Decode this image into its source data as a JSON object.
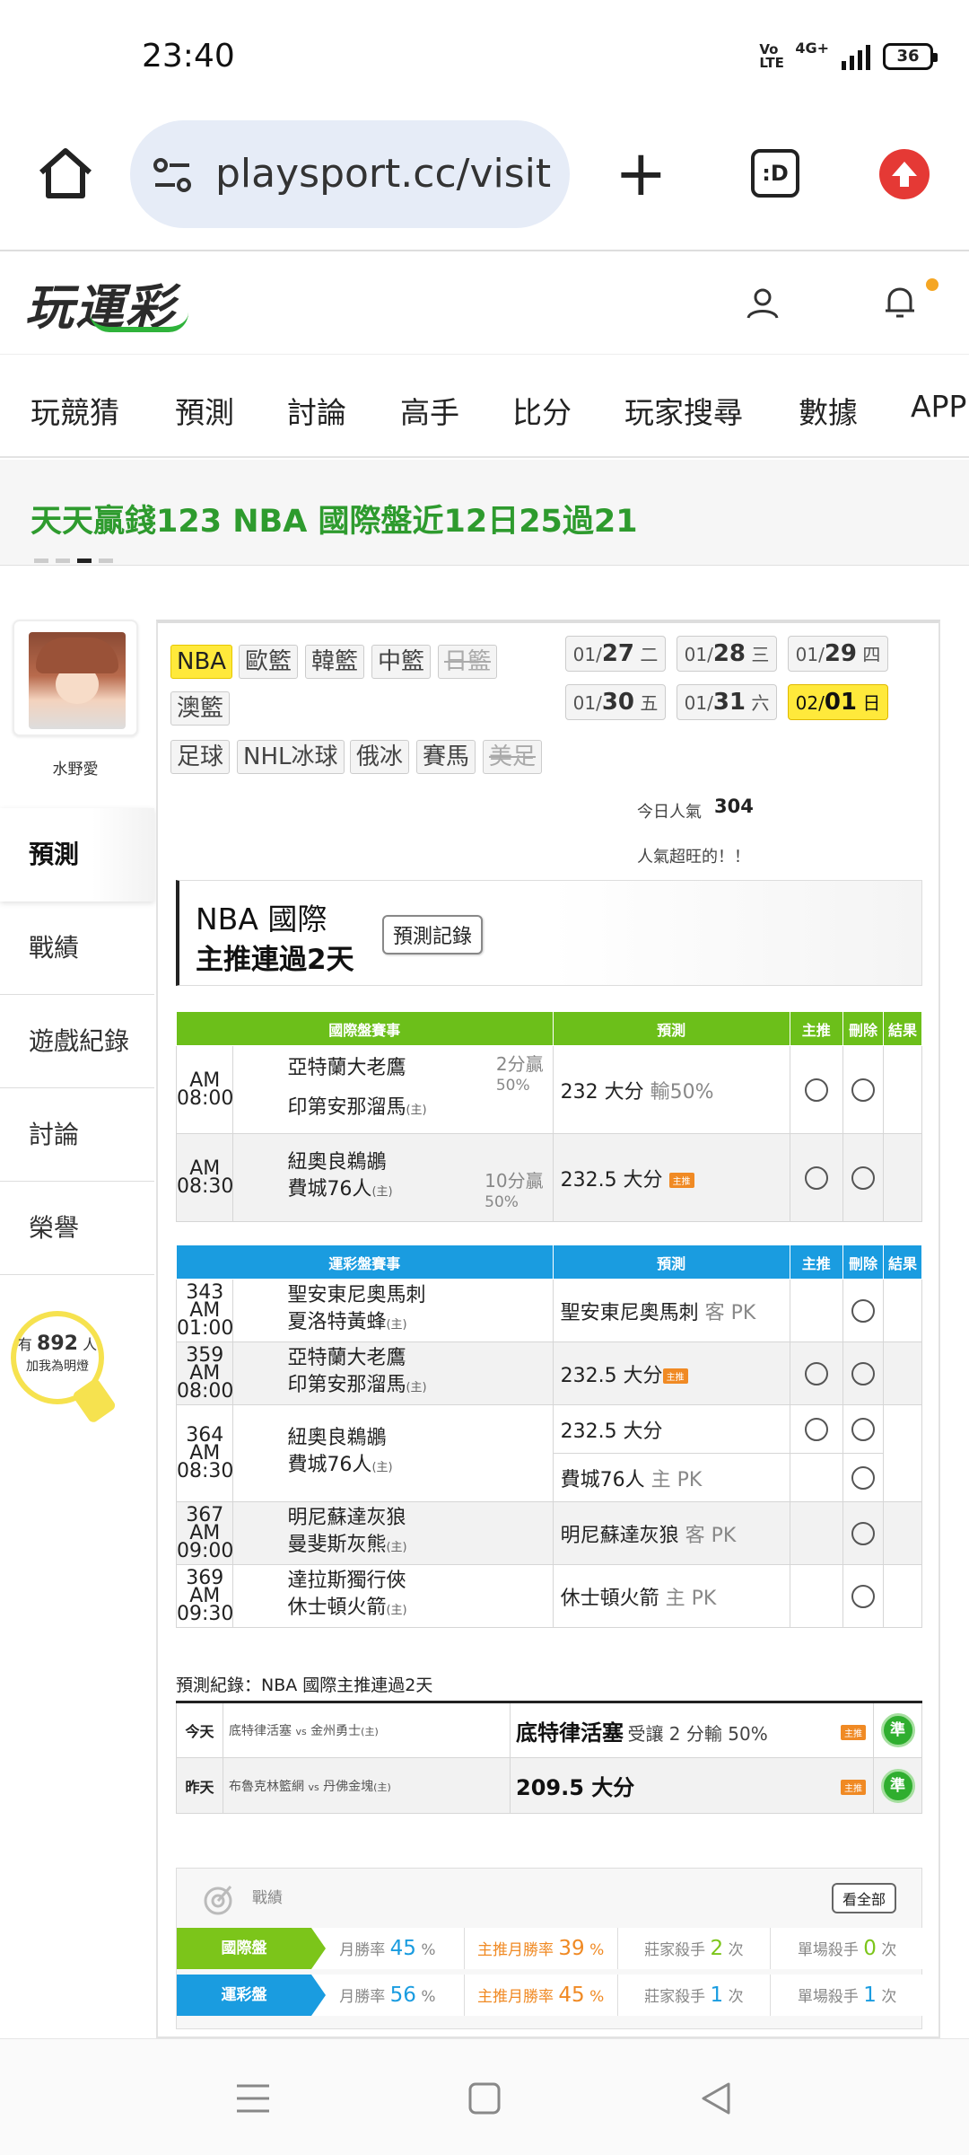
{
  "status_bar": {
    "time": "23:40",
    "volte": "Vo LTE",
    "network": "4G+",
    "battery": "36"
  },
  "browser": {
    "url": "playsport.cc/visit",
    "tabs_label": ":D"
  },
  "site": {
    "logo": "玩運彩",
    "nav": [
      "玩競猜",
      "預測",
      "討論",
      "高手",
      "比分",
      "玩家搜尋",
      "數據",
      "APP"
    ]
  },
  "promo": {
    "text": "天天贏錢123  NBA 國際盤近12日25過21"
  },
  "sidebar": {
    "username": "水野愛",
    "items": [
      "預測",
      "戰績",
      "遊戲紀錄",
      "討論",
      "榮譽"
    ],
    "fans_prefix": "有",
    "fans_count": "892",
    "fans_suffix": "人",
    "fans_text": "加我為明燈"
  },
  "leagues": [
    {
      "label": "NBA",
      "state": "on"
    },
    {
      "label": "歐籃",
      "state": ""
    },
    {
      "label": "韓籃",
      "state": ""
    },
    {
      "label": "中籃",
      "state": ""
    },
    {
      "label": "日籃",
      "state": "off"
    },
    {
      "label": "澳籃",
      "state": ""
    },
    {
      "label": "足球",
      "state": ""
    },
    {
      "label": "NHL冰球",
      "state": ""
    },
    {
      "label": "俄冰",
      "state": ""
    },
    {
      "label": "賽馬",
      "state": ""
    },
    {
      "label": "美足",
      "state": "off"
    }
  ],
  "dates": [
    {
      "month": "01/",
      "day": "27",
      "wd": "二",
      "on": false
    },
    {
      "month": "01/",
      "day": "28",
      "wd": "三",
      "on": false
    },
    {
      "month": "01/",
      "day": "29",
      "wd": "四",
      "on": false
    },
    {
      "month": "01/",
      "day": "30",
      "wd": "五",
      "on": false
    },
    {
      "month": "01/",
      "day": "31",
      "wd": "六",
      "on": false
    },
    {
      "month": "02/",
      "day": "01",
      "wd": "日",
      "on": true
    }
  ],
  "popularity": {
    "label": "今日人氣",
    "value": "304",
    "note": "人氣超旺的！！"
  },
  "headline": {
    "title": "NBA 國際",
    "subtitle": "主推連過2天",
    "button": "預測記錄"
  },
  "intl_table": {
    "headers": [
      "國際盤賽事",
      "預測",
      "主推",
      "刪除",
      "結果"
    ],
    "rows": [
      {
        "time": "AM 08:00",
        "away": "亞特蘭大老鷹",
        "home": "印第安那溜馬",
        "home_tag": "(主)",
        "handicap": "2分贏",
        "handicap_pct": "50%",
        "pick": "232 大分",
        "pick_note": "輸50%",
        "tag": "",
        "main_radio": true,
        "del_radio": true
      },
      {
        "time": "AM 08:30",
        "away": "紐奧良鵜鶘",
        "home": "費城76人",
        "home_tag": "(主)",
        "handicap": "10分贏",
        "handicap_pct": "50%",
        "pick": "232.5 大分",
        "pick_note": "",
        "tag": "主推",
        "main_radio": true,
        "del_radio": true
      }
    ]
  },
  "lottery_table": {
    "headers": [
      "運彩盤賽事",
      "預測",
      "主推",
      "刪除",
      "結果"
    ],
    "rows": [
      {
        "no": "343",
        "time": "AM 01:00",
        "away": "聖安東尼奧馬刺",
        "home": "夏洛特黃蜂",
        "home_tag": "(主)",
        "picks": [
          {
            "text": "聖安東尼奧馬刺",
            "note": "客 PK",
            "tag": "",
            "main": false,
            "del": true
          }
        ]
      },
      {
        "no": "359",
        "time": "AM 08:00",
        "away": "亞特蘭大老鷹",
        "home": "印第安那溜馬",
        "home_tag": "(主)",
        "picks": [
          {
            "text": "232.5 大分",
            "note": "",
            "tag": "主推",
            "main": true,
            "del": true
          }
        ]
      },
      {
        "no": "364",
        "time": "AM 08:30",
        "away": "紐奧良鵜鶘",
        "home": "費城76人",
        "home_tag": "(主)",
        "picks": [
          {
            "text": "232.5 大分",
            "note": "",
            "tag": "",
            "main": true,
            "del": true
          },
          {
            "text": "費城76人",
            "note": "主 PK",
            "tag": "",
            "main": false,
            "del": true
          }
        ]
      },
      {
        "no": "367",
        "time": "AM 09:00",
        "away": "明尼蘇達灰狼",
        "home": "曼斐斯灰熊",
        "home_tag": "(主)",
        "picks": [
          {
            "text": "明尼蘇達灰狼",
            "note": "客 PK",
            "tag": "",
            "main": false,
            "del": true
          }
        ]
      },
      {
        "no": "369",
        "time": "AM 09:30",
        "away": "達拉斯獨行俠",
        "home": "休士頓火箭",
        "home_tag": "(主)",
        "picks": [
          {
            "text": "休士頓火箭",
            "note": "主 PK",
            "tag": "",
            "main": false,
            "del": true
          }
        ]
      }
    ]
  },
  "records": {
    "title": "預測紀錄：NBA 國際主推連過2天",
    "rows": [
      {
        "day": "今天",
        "away": "底特律活塞",
        "vs": "vs",
        "home": "金州勇士",
        "home_tag": "(主)",
        "pick": "底特律活塞",
        "note": "受讓 2 分輸 50%",
        "tag": "主推",
        "result": "準"
      },
      {
        "day": "昨天",
        "away": "布魯克林籃網",
        "vs": "vs",
        "home": "丹佛金塊",
        "home_tag": "(主)",
        "pick": "209.5 大分",
        "note": "",
        "tag": "主推",
        "result": "準"
      }
    ]
  },
  "stats": {
    "title": "戰績",
    "view_all": "看全部",
    "rows": [
      {
        "label": "國際盤",
        "color": "#7cc51a",
        "win_label": "月勝率",
        "win": "45",
        "main_label": "主推月勝率",
        "main": "39",
        "killer_label": "莊家殺手",
        "killer": "2",
        "single_label": "單場殺手",
        "single": "0",
        "unit": "%",
        "times": "次"
      },
      {
        "label": "運彩盤",
        "color": "#1a9ce0",
        "win_label": "月勝率",
        "win": "56",
        "main_label": "主推月勝率",
        "main": "45",
        "killer_label": "莊家殺手",
        "killer": "1",
        "single_label": "單場殺手",
        "single": "1",
        "unit": "%",
        "times": "次"
      }
    ]
  },
  "colors": {
    "green": "#6cbf1a",
    "blue": "#1a9ce0",
    "promo_green": "#2e9b2e",
    "highlight": "#ffe93b",
    "accent_orange": "#f08a24"
  }
}
